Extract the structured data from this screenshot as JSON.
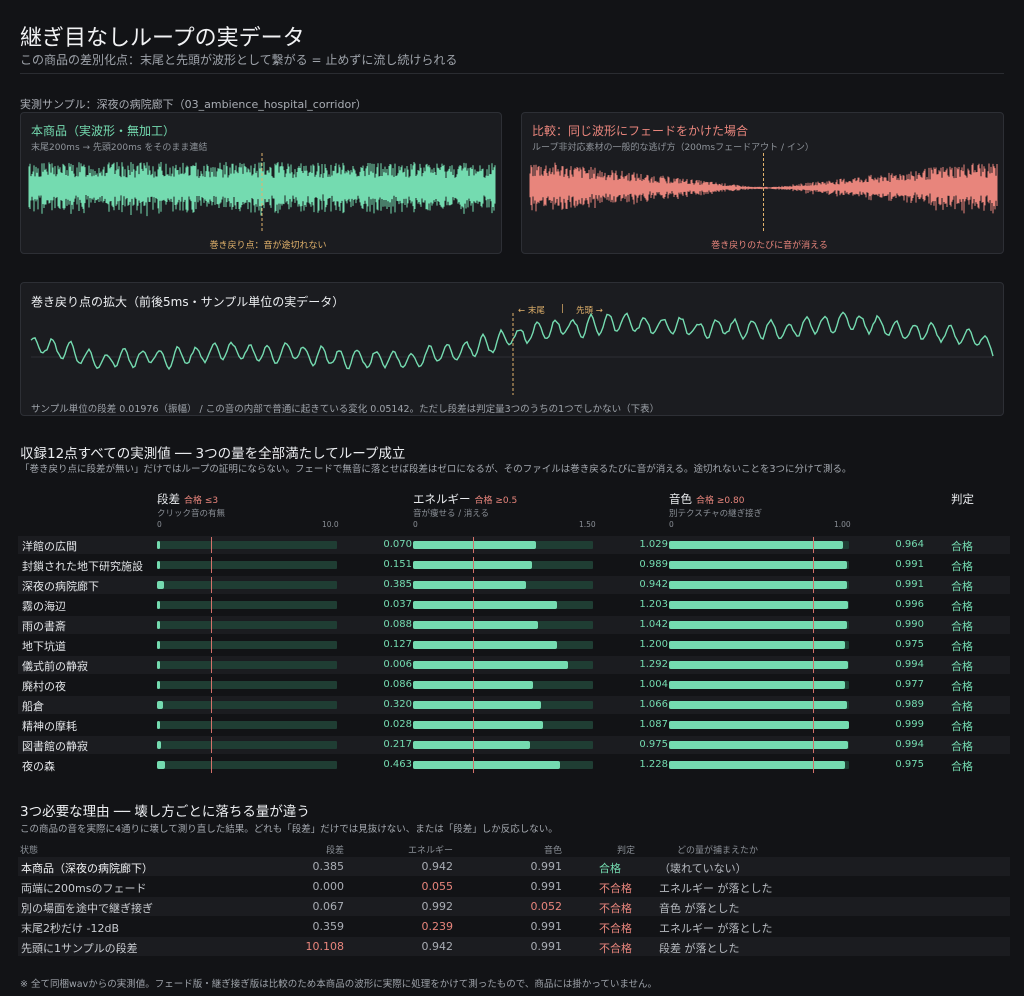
{
  "header": {
    "title": "継ぎ目なしループの実データ",
    "subtitle": "この商品の差別化点：末尾と先頭が波形として繋がる = 止めずに流し続けられる"
  },
  "sample_label": "実測サンプル：深夜の病院廊下（03_ambience_hospital_corridor）",
  "panel_product": {
    "title": "本商品（実波形・無加工）",
    "desc": "末尾200ms → 先頭200ms をそのまま連結",
    "marker_label": "巻き戻り点：音が途切れない"
  },
  "panel_compare": {
    "title": "比較：同じ波形にフェードをかけた場合",
    "desc": "ループ非対応素材の一般的な逃げ方（200msフェードアウト / イン）",
    "marker_label": "巻き戻りのたびに音が消える"
  },
  "zoom_panel": {
    "title": "巻き戻り点の拡大（前後5ms・サンプル単位の実データ）",
    "left_label": "← 末尾",
    "separator": "|",
    "right_label": "先頭 →",
    "caption": "サンプル単位の段差 0.01976（振幅） / この音の内部で普通に起きている変化 0.05142。ただし段差は判定量3つのうちの1つでしかない（下表）"
  },
  "section1": {
    "title": "収録12点すべての実測値 ── 3つの量を全部満たしてループ成立",
    "note": "「巻き戻り点に段差が無い」だけではループの証明にならない。フェードで無音に落とせば段差はゼロになるが、そのファイルは巻き戻るたびに音が消える。途切れないことを3つに分けて測る。"
  },
  "columns": {
    "step": {
      "name": "段差",
      "threshold": "合格 ≤3",
      "desc": "クリック音の有無",
      "tick_min": "0",
      "tick_max": "10.0"
    },
    "energy": {
      "name": "エネルギー",
      "threshold": "合格 ≥0.5",
      "desc": "音が痩せる / 消える",
      "tick_min": "0",
      "tick_max": "1.50"
    },
    "timbre": {
      "name": "音色",
      "threshold": "合格 ≥0.80",
      "desc": "別テクスチャの継ぎ接ぎ",
      "tick_min": "0",
      "tick_max": "1.00"
    },
    "verdict": {
      "name": "判定"
    }
  },
  "colors": {
    "accent_green": "#74dbb0",
    "accent_red": "#e8857c",
    "gold": "#e2b26b",
    "background": "#121316"
  },
  "chart_data": {
    "type": "bar",
    "categories": [
      "洋館の広間",
      "封鎖された地下研究施設",
      "深夜の病院廊下",
      "霧の海辺",
      "雨の書斎",
      "地下坑道",
      "儀式前の静寂",
      "廃村の夜",
      "船倉",
      "精神の摩耗",
      "図書館の静寂",
      "夜の森"
    ],
    "series": [
      {
        "name": "段差",
        "values": [
          "0.070",
          "0.151",
          "0.385",
          "0.037",
          "0.088",
          "0.127",
          "0.006",
          "0.086",
          "0.320",
          "0.028",
          "0.217",
          "0.463"
        ],
        "xlim": [
          0,
          10
        ],
        "threshold": 3
      },
      {
        "name": "エネルギー",
        "values": [
          "1.029",
          "0.989",
          "0.942",
          "1.203",
          "1.042",
          "1.200",
          "1.292",
          "1.004",
          "1.066",
          "1.087",
          "0.975",
          "1.228"
        ],
        "xlim": [
          0,
          1.5
        ],
        "threshold": 0.5
      },
      {
        "name": "音色",
        "values": [
          "0.964",
          "0.991",
          "0.991",
          "0.996",
          "0.990",
          "0.975",
          "0.994",
          "0.977",
          "0.989",
          "0.999",
          "0.994",
          "0.975"
        ],
        "xlim": [
          0,
          1.0
        ],
        "threshold": 0.8
      }
    ],
    "verdicts": [
      "合格",
      "合格",
      "合格",
      "合格",
      "合格",
      "合格",
      "合格",
      "合格",
      "合格",
      "合格",
      "合格",
      "合格"
    ]
  },
  "section2": {
    "title": "3つ必要な理由 ── 壊し方ごとに落ちる量が違う",
    "note": "この商品の音を実際に4通りに壊して測り直した結果。どれも「段差」だけでは見抜けない、または「段差」しか反応しない。",
    "headers": [
      "状態",
      "段差",
      "エネルギー",
      "音色",
      "判定",
      "どの量が捕まえたか"
    ],
    "rows": [
      {
        "state": "本商品（深夜の病院廊下）",
        "step": "0.385",
        "energy": "0.942",
        "timbre": "0.991",
        "verdict": "合格",
        "caught": "（壊れていない）",
        "fail": []
      },
      {
        "state": "両端に200msのフェード",
        "step": "0.000",
        "energy": "0.055",
        "timbre": "0.991",
        "verdict": "不合格",
        "caught": "エネルギー が落とした",
        "fail": [
          "energy"
        ]
      },
      {
        "state": "別の場面を途中で継ぎ接ぎ",
        "step": "0.067",
        "energy": "0.992",
        "timbre": "0.052",
        "verdict": "不合格",
        "caught": "音色 が落とした",
        "fail": [
          "timbre"
        ]
      },
      {
        "state": "末尾2秒だけ -12dB",
        "step": "0.359",
        "energy": "0.239",
        "timbre": "0.991",
        "verdict": "不合格",
        "caught": "エネルギー が落とした",
        "fail": [
          "energy"
        ]
      },
      {
        "state": "先頭に1サンプルの段差",
        "step": "10.108",
        "energy": "0.942",
        "timbre": "0.991",
        "verdict": "不合格",
        "caught": "段差 が落とした",
        "fail": [
          "step"
        ]
      }
    ]
  },
  "footer": "※ 全て同梱wavからの実測値。フェード版・継ぎ接ぎ版は比較のため本商品の波形に実際に処理をかけて測ったもので、商品には掛かっていません。"
}
